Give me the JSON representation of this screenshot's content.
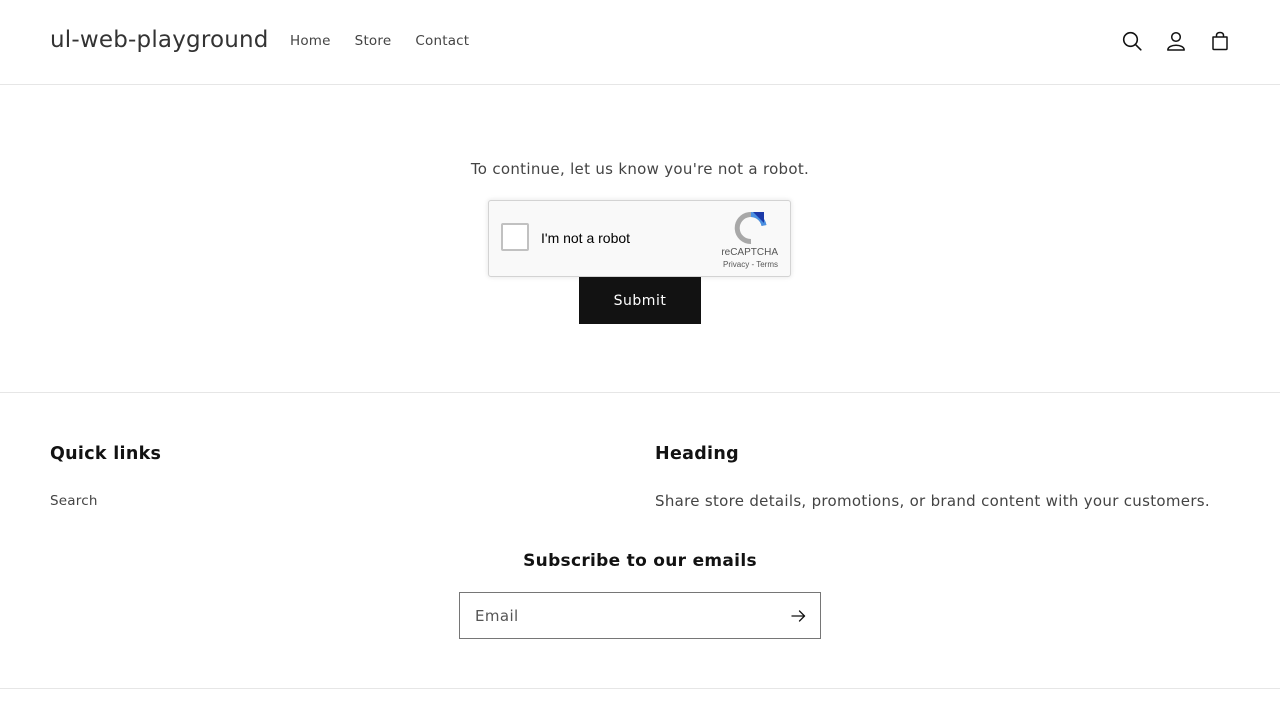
{
  "header": {
    "logo": "ul-web-playground",
    "nav": [
      {
        "label": "Home"
      },
      {
        "label": "Store"
      },
      {
        "label": "Contact"
      }
    ],
    "icons": [
      "search-icon",
      "account-icon",
      "cart-icon"
    ]
  },
  "main": {
    "challenge_text": "To continue, let us know you're not a robot.",
    "recaptcha": {
      "checkbox_label": "I'm not a robot",
      "brand": "reCAPTCHA",
      "privacy": "Privacy",
      "separator": " - ",
      "terms": "Terms",
      "checked": false,
      "accent_color": "#1c3aa9"
    },
    "submit_label": "Submit"
  },
  "footer": {
    "quick_links": {
      "heading": "Quick links",
      "links": [
        {
          "label": "Search"
        }
      ]
    },
    "custom": {
      "heading": "Heading",
      "text": "Share store details, promotions, or brand content with your customers."
    },
    "newsletter": {
      "heading": "Subscribe to our emails",
      "placeholder": "Email",
      "value": ""
    }
  },
  "colors": {
    "text": "#121212",
    "muted_text": "#444444",
    "button_bg": "#121212",
    "divider": "#e6e6e6"
  }
}
